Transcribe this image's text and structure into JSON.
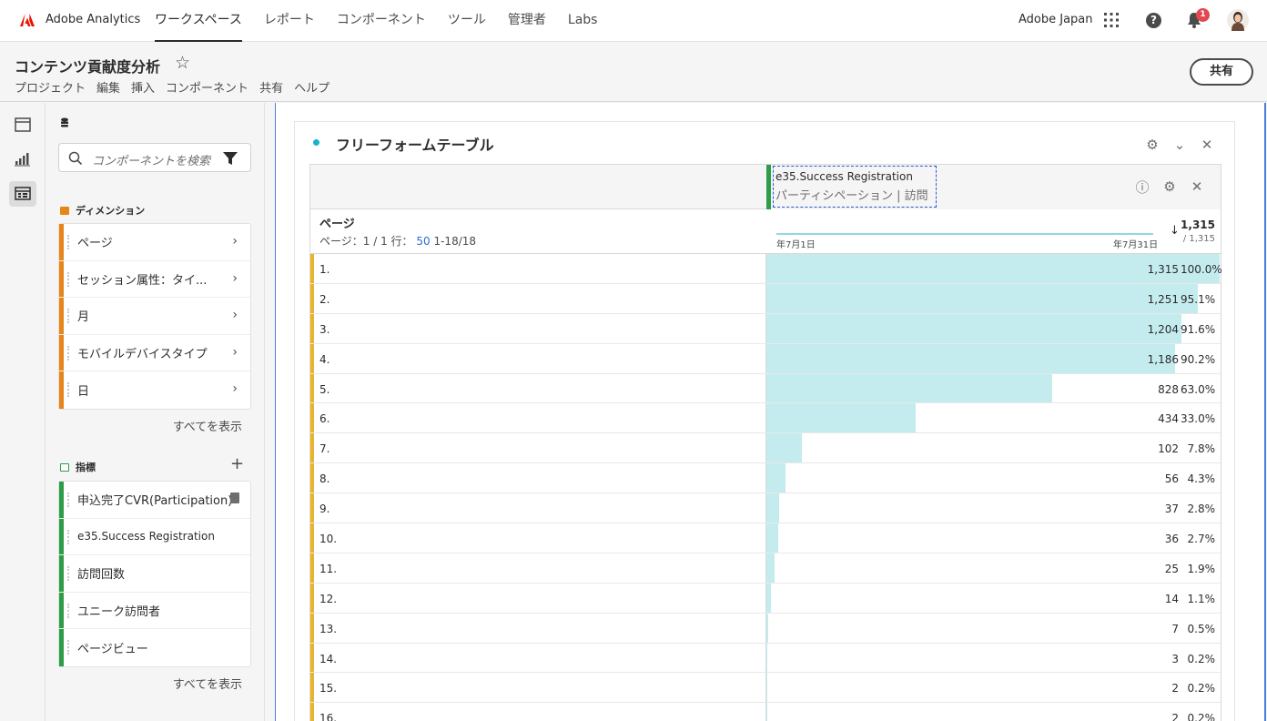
{
  "topnav": {
    "app_name": "Adobe Analytics",
    "items": [
      "ワークスペース",
      "レポート",
      "コンポーネント",
      "ツール",
      "管理者",
      "Labs"
    ],
    "active_index": 0,
    "org": "Adobe Japan",
    "notification_count": "1"
  },
  "project": {
    "title": "コンテンツ貢献度分析",
    "menu": [
      "プロジェクト",
      "編集",
      "挿入",
      "コンポーネント",
      "共有",
      "ヘルプ"
    ],
    "share_label": "共有"
  },
  "panel": {
    "search_placeholder": "コンポーネントを検索",
    "dimensions_heading": "ディメンション",
    "dimensions": [
      "ページ",
      "セッション属性：タイ...",
      "月",
      "モバイルデバイスタイプ",
      "日"
    ],
    "metrics_heading": "指標",
    "metrics": [
      "申込完了CVR(Participation)",
      "e35.Success Registration",
      "訪問回数",
      "ユニーク訪問者",
      "ページビュー"
    ],
    "show_all": "すべてを表示"
  },
  "freeform": {
    "title": "フリーフォームテーブル",
    "metric_name": "e35.Success Registration",
    "metric_sub": "パーティシペーション | 訪問",
    "dimension": "ページ",
    "pager_label": "ページ：1 / 1 行：",
    "rows_per_page": "50",
    "range": "1-18/18",
    "date_start": "年7月1日",
    "date_end": "年7月31日",
    "total": "1,315",
    "total_sub": "/ 1,315",
    "rows": [
      {
        "n": "1.",
        "value": "1,315",
        "pct": "100.0%",
        "ratio": 1.0
      },
      {
        "n": "2.",
        "value": "1,251",
        "pct": "95.1%",
        "ratio": 0.951
      },
      {
        "n": "3.",
        "value": "1,204",
        "pct": "91.6%",
        "ratio": 0.916
      },
      {
        "n": "4.",
        "value": "1,186",
        "pct": "90.2%",
        "ratio": 0.902
      },
      {
        "n": "5.",
        "value": "828",
        "pct": "63.0%",
        "ratio": 0.63
      },
      {
        "n": "6.",
        "value": "434",
        "pct": "33.0%",
        "ratio": 0.33
      },
      {
        "n": "7.",
        "value": "102",
        "pct": "7.8%",
        "ratio": 0.078
      },
      {
        "n": "8.",
        "value": "56",
        "pct": "4.3%",
        "ratio": 0.043
      },
      {
        "n": "9.",
        "value": "37",
        "pct": "2.8%",
        "ratio": 0.028
      },
      {
        "n": "10.",
        "value": "36",
        "pct": "2.7%",
        "ratio": 0.027
      },
      {
        "n": "11.",
        "value": "25",
        "pct": "1.9%",
        "ratio": 0.019
      },
      {
        "n": "12.",
        "value": "14",
        "pct": "1.1%",
        "ratio": 0.011
      },
      {
        "n": "13.",
        "value": "7",
        "pct": "0.5%",
        "ratio": 0.005
      },
      {
        "n": "14.",
        "value": "3",
        "pct": "0.2%",
        "ratio": 0.002
      },
      {
        "n": "15.",
        "value": "2",
        "pct": "0.2%",
        "ratio": 0.002
      },
      {
        "n": "16.",
        "value": "2",
        "pct": "0.2%",
        "ratio": 0.002
      }
    ]
  },
  "colors": {
    "dimension_accent": "#e68619",
    "metric_accent": "#2d9d48",
    "bar_fill": "#c4ecef",
    "focus_border": "#4a7ed8"
  }
}
